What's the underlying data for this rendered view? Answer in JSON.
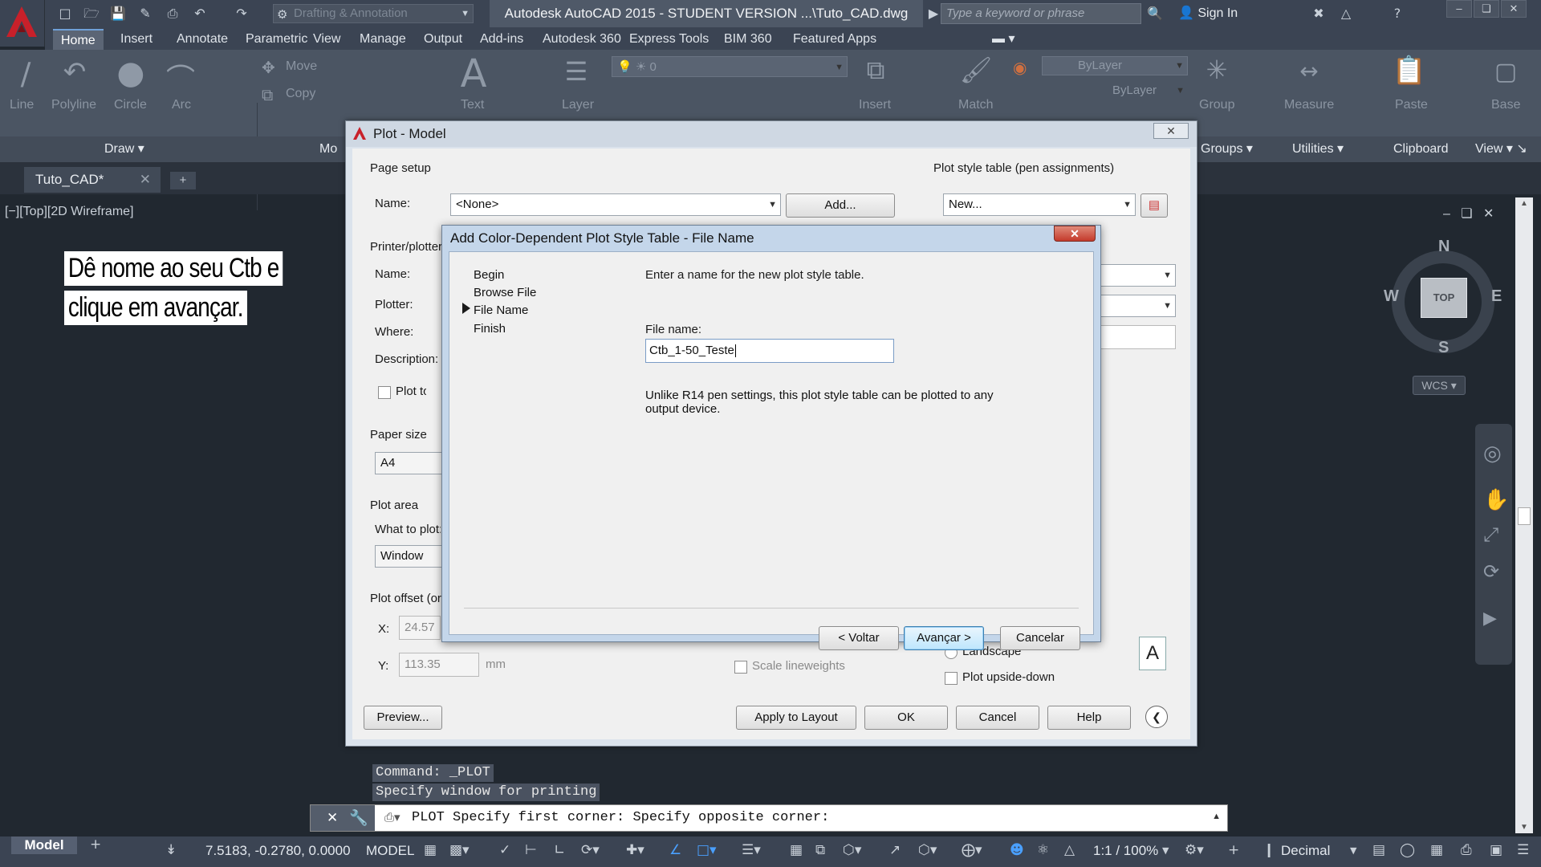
{
  "titlebar": {
    "workspace": "Drafting & Annotation",
    "window_title": "Autodesk AutoCAD 2015 - STUDENT VERSION    ...\\Tuto_CAD.dwg",
    "search_placeholder": "Type a keyword or phrase",
    "sign_in": "Sign In"
  },
  "ribbon_tabs": [
    "Home",
    "Insert",
    "Annotate",
    "Parametric",
    "View",
    "Manage",
    "Output",
    "Add-ins",
    "Autodesk 360",
    "Express Tools",
    "BIM 360",
    "Featured Apps"
  ],
  "ribbon": {
    "draw_tools": [
      "Line",
      "Polyline",
      "Circle",
      "Arc"
    ],
    "modify_tools": [
      "Move",
      "Copy"
    ],
    "text": "Text",
    "layer": "Layer",
    "insert": "Insert",
    "match": "Match",
    "group": "Group",
    "measure": "Measure",
    "paste": "Paste",
    "base": "Base",
    "bylayer_1": "ByLayer",
    "bylayer_2": "ByLayer",
    "layer_value": "0",
    "panels": [
      "Draw",
      "Mo",
      "Groups",
      "Utilities",
      "Clipboard",
      "View"
    ]
  },
  "file_tabs": {
    "active": "Tuto_CAD*"
  },
  "viewport": {
    "label": "[−][Top][2D Wireframe]",
    "viewcube": {
      "top": "TOP",
      "n": "N",
      "s": "S",
      "e": "E",
      "w": "W",
      "wcs": "WCS"
    }
  },
  "annotation": {
    "line1": "Dê nome ao seu Ctb e",
    "line2": "clique em avançar."
  },
  "plot_dialog": {
    "title": "Plot - Model",
    "page_setup_label": "Page setup",
    "name_label": "Name:",
    "page_setup_name": "<None>",
    "add_button": "Add...",
    "plot_style_label": "Plot style table (pen assignments)",
    "plot_style_value": "New...",
    "printer_label": "Printer/plotter",
    "printer_name_label": "Name:",
    "plotter_label": "Plotter:",
    "where_label": "Where:",
    "description_label": "Description:",
    "plot_to_file": "Plot to file",
    "paper_size_label": "Paper size",
    "paper_size": "A4",
    "plot_area_label": "Plot area",
    "what_to_plot": "What to plot:",
    "what_to_plot_value": "Window",
    "plot_offset_label": "Plot offset (origin set to printable area)",
    "x_label": "X:",
    "x_value": "24.57",
    "y_label": "Y:",
    "y_value": "113.35",
    "unit": "mm",
    "scale_lineweights": "Scale lineweights",
    "landscape": "Landscape",
    "upside_down": "Plot upside-down",
    "preview_button": "Preview...",
    "apply_button": "Apply to Layout",
    "ok_button": "OK",
    "cancel_button": "Cancel",
    "help_button": "Help"
  },
  "wizard": {
    "title": "Add Color-Dependent Plot Style Table - File Name",
    "steps": [
      "Begin",
      "Browse File",
      "File Name",
      "Finish"
    ],
    "current_step": "File Name",
    "intro": "Enter a name for the new plot style table.",
    "file_name_label": "File name:",
    "file_name_value": "Ctb_1-50_Teste",
    "note": "Unlike R14 pen settings, this plot style table can be plotted to any output device.",
    "back_button": "< Voltar",
    "next_button": "Avançar >",
    "cancel_button": "Cancelar"
  },
  "command": {
    "history_1": "Command:  _PLOT",
    "history_2": "Specify window for printing",
    "current": "PLOT Specify first corner: Specify opposite corner:"
  },
  "statusbar": {
    "model_tab": "Model",
    "coordinates": "7.5183, -0.2780, 0.0000",
    "mode": "MODEL",
    "scale": "1:1 / 100%",
    "units": "Decimal"
  }
}
